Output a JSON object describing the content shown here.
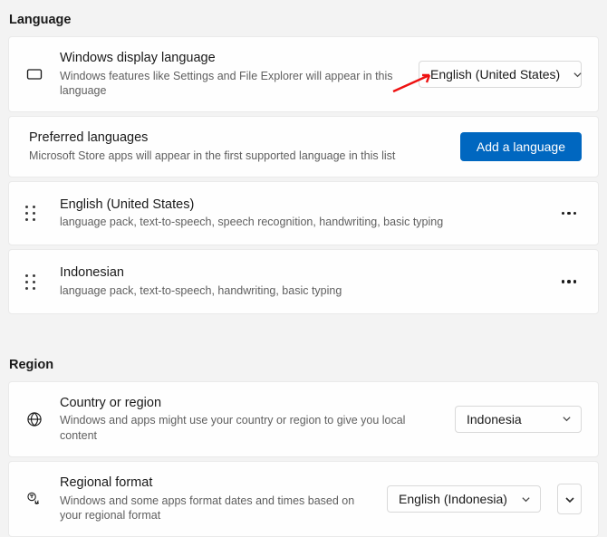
{
  "language": {
    "heading": "Language",
    "display": {
      "title": "Windows display language",
      "subtitle": "Windows features like Settings and File Explorer will appear in this language",
      "selected": "English (United States)"
    },
    "preferred": {
      "title": "Preferred languages",
      "subtitle": "Microsoft Store apps will appear in the first supported language in this list",
      "add_button": "Add a language"
    },
    "items": [
      {
        "name": "English (United States)",
        "features": "language pack, text-to-speech, speech recognition, handwriting, basic typing"
      },
      {
        "name": "Indonesian",
        "features": "language pack, text-to-speech, handwriting, basic typing"
      }
    ]
  },
  "region": {
    "heading": "Region",
    "country": {
      "title": "Country or region",
      "subtitle": "Windows and apps might use your country or region to give you local content",
      "selected": "Indonesia"
    },
    "format": {
      "title": "Regional format",
      "subtitle": "Windows and some apps format dates and times based on your regional format",
      "selected": "English (Indonesia)"
    }
  }
}
